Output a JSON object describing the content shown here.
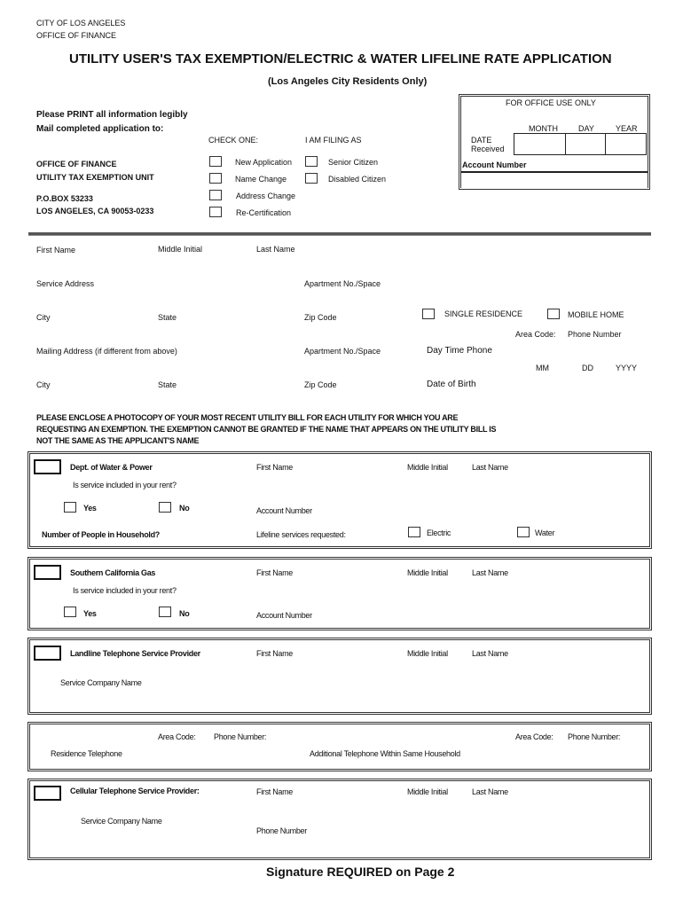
{
  "header": {
    "agency_line1": "CITY OF LOS ANGELES",
    "agency_line2": "OFFICE OF FINANCE",
    "title": "UTILITY USER'S TAX EXEMPTION/ELECTRIC & WATER LIFELINE RATE APPLICATION",
    "subtitle": "(Los Angeles City Residents Only)"
  },
  "instructions": {
    "print_note": "Please PRINT all information legibly",
    "mail_note": "Mail completed application to:",
    "address": [
      "OFFICE OF FINANCE",
      "UTILITY TAX EXEMPTION UNIT",
      "P.O.BOX 53233",
      "LOS ANGELES, CA 90053-0233"
    ]
  },
  "check_one": {
    "label": "CHECK ONE:",
    "options": [
      "New Application",
      "Name Change",
      "Address Change",
      "Re-Certification"
    ]
  },
  "filing_as": {
    "label": "I AM FILING AS",
    "options": [
      "Senior Citizen",
      "Disabled Citizen"
    ]
  },
  "office_use": {
    "title": "FOR OFFICE USE ONLY",
    "month": "MONTH",
    "day": "DAY",
    "year": "YEAR",
    "date_received_line1": "DATE",
    "date_received_line2": "Received",
    "account_number": "Account Number"
  },
  "applicant": {
    "first_name": "First Name",
    "middle_initial": "Middle Initial",
    "last_name": "Last Name",
    "service_address": "Service Address",
    "apartment": "Apartment No./Space",
    "city": "City",
    "state": "State",
    "zip": "Zip Code",
    "mailing_address": "Mailing Address (if different from above)",
    "single_residence": "SINGLE RESIDENCE",
    "mobile_home": "MOBILE HOME",
    "area_code": "Area Code:",
    "phone_number": "Phone Number",
    "day_time_phone": "Day Time Phone",
    "mm": "MM",
    "dd": "DD",
    "yyyy": "YYYY",
    "date_of_birth": "Date of Birth"
  },
  "notice": {
    "line1": "PLEASE ENCLOSE A PHOTOCOPY OF YOUR MOST RECENT UTILITY BILL FOR EACH UTILITY FOR WHICH YOU ARE",
    "line2": "REQUESTING AN EXEMPTION.  THE EXEMPTION CANNOT BE GRANTED IF THE NAME THAT APPEARS ON THE UTILITY BILL IS",
    "line3": "NOT THE SAME AS THE APPLICANT'S NAME"
  },
  "dwp": {
    "title": "Dept. of  Water & Power",
    "rent_question": "Is service included in your rent?",
    "yes": "Yes",
    "no": "No",
    "household": "Number of People in Household?",
    "first_name": "First Name",
    "middle_initial": "Middle Initial",
    "last_name": "Last Name",
    "account_number": "Account Number",
    "lifeline": "Lifeline services requested:",
    "electric": "Electric",
    "water": "Water"
  },
  "gas": {
    "title": "Southern California Gas",
    "rent_question": "Is service included in your rent?",
    "yes": "Yes",
    "no": "No",
    "first_name": "First Name",
    "middle_initial": "Middle Initial",
    "last_name": "Last Name",
    "account_number": "Account Number"
  },
  "landline": {
    "title": "Landline Telephone Service Provider",
    "first_name": "First Name",
    "middle_initial": "Middle Initial",
    "last_name": "Last Name",
    "service_company": "Service Company Name"
  },
  "residence_phone": {
    "area_code": "Area Code:",
    "phone_number": "Phone Number:",
    "label": "Residence Telephone",
    "additional_label": "Additional Telephone Within Same Household",
    "area_code2": "Area Code:",
    "phone_number2": "Phone Number:"
  },
  "cellular": {
    "title": "Cellular Telephone Service Provider:",
    "first_name": "First Name",
    "middle_initial": "Middle Initial",
    "last_name": "Last Name",
    "service_company": "Service Company Name",
    "phone_number": "Phone Number"
  },
  "footer": {
    "signature_note": "Signature REQUIRED on Page 2"
  }
}
